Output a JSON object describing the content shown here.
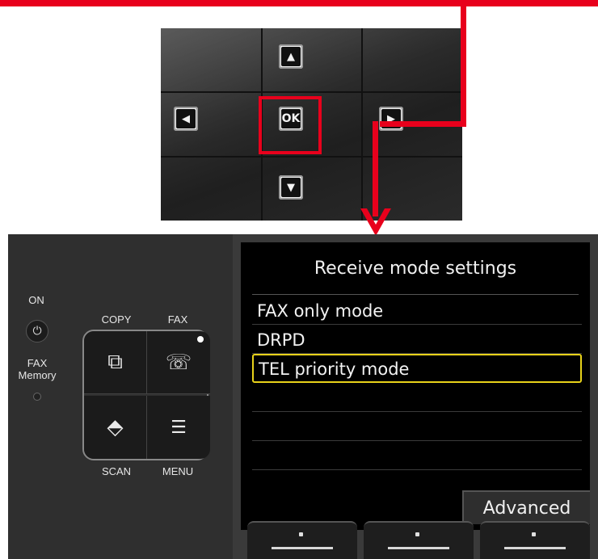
{
  "nav_pad": {
    "up_icon": "up-arrow-icon",
    "left_icon": "left-arrow-icon",
    "right_icon": "right-arrow-icon",
    "down_icon": "down-arrow-icon",
    "ok_label": "OK",
    "highlight_color": "#e8001c"
  },
  "panel": {
    "on_label": "ON",
    "fax_memory_label": "FAX\nMemory",
    "copy_label": "COPY",
    "fax_label": "FAX",
    "scan_label": "SCAN",
    "menu_label": "MENU",
    "icons": {
      "power": "power-icon",
      "copy": "copy-icon",
      "fax": "fax-icon",
      "scan": "scan-icon",
      "menu": "menu-icon"
    }
  },
  "lcd": {
    "title": "Receive mode settings",
    "options": [
      {
        "label": "FAX only mode",
        "selected": false
      },
      {
        "label": "DRPD",
        "selected": false
      },
      {
        "label": "TEL priority mode",
        "selected": true
      }
    ],
    "advanced_label": "Advanced",
    "selection_color": "#e8d21a"
  }
}
